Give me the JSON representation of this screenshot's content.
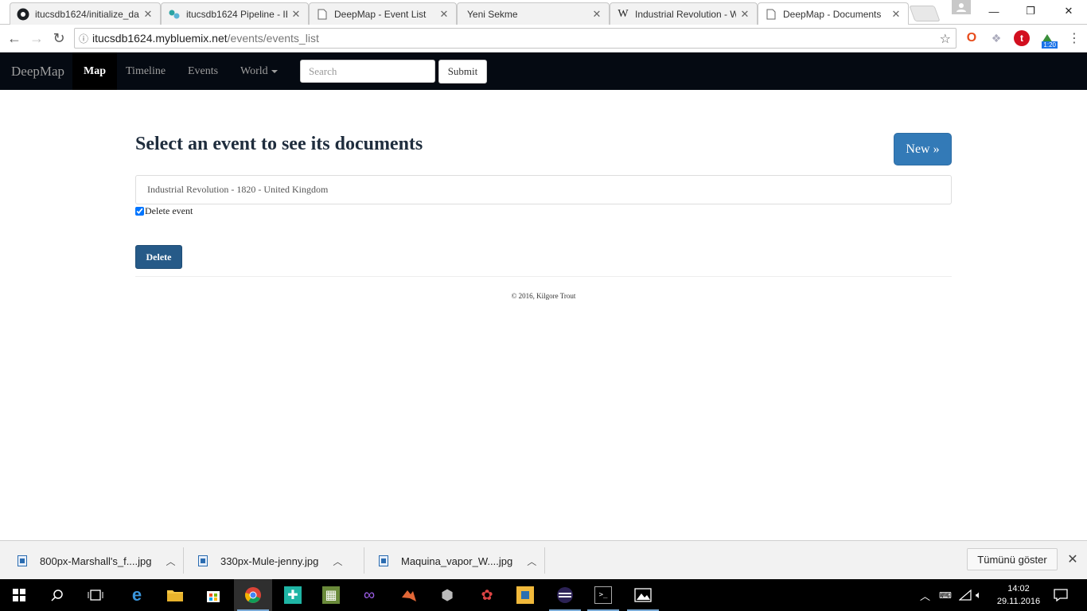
{
  "browser": {
    "tabs": [
      {
        "title": "itucsdb1624/initialize_da",
        "icon": "github-icon"
      },
      {
        "title": "itucsdb1624 Pipeline - IB",
        "icon": "pipeline-icon"
      },
      {
        "title": "DeepMap - Event List",
        "icon": "page-icon"
      },
      {
        "title": "Yeni Sekme",
        "icon": "none"
      },
      {
        "title": "Industrial Revolution - W",
        "icon": "wikipedia-icon"
      },
      {
        "title": "DeepMap - Documents",
        "icon": "page-icon",
        "active": true
      }
    ],
    "url_host": "itucsdb1624.mybluemix.net",
    "url_path": "/events/events_list",
    "timer_badge": "1:20"
  },
  "site": {
    "brand": "DeepMap",
    "nav": {
      "map": "Map",
      "timeline": "Timeline",
      "events": "Events",
      "world": "World"
    },
    "search_placeholder": "Search",
    "submit_label": "Submit"
  },
  "main": {
    "title": "Select an event to see its documents",
    "new_button": "New »",
    "events": [
      "Industrial Revolution - 1820 - United Kingdom"
    ],
    "delete_checkbox_label": "Delete event",
    "delete_checkbox_checked": true,
    "delete_button": "Delete",
    "footer": "© 2016, Kilgore Trout"
  },
  "downloads": {
    "items": [
      "800px-Marshall's_f....jpg",
      "330px-Mule-jenny.jpg",
      "Maquina_vapor_W....jpg"
    ],
    "show_all": "Tümünü göster"
  },
  "taskbar": {
    "time": "14:02",
    "date": "29.11.2016"
  }
}
